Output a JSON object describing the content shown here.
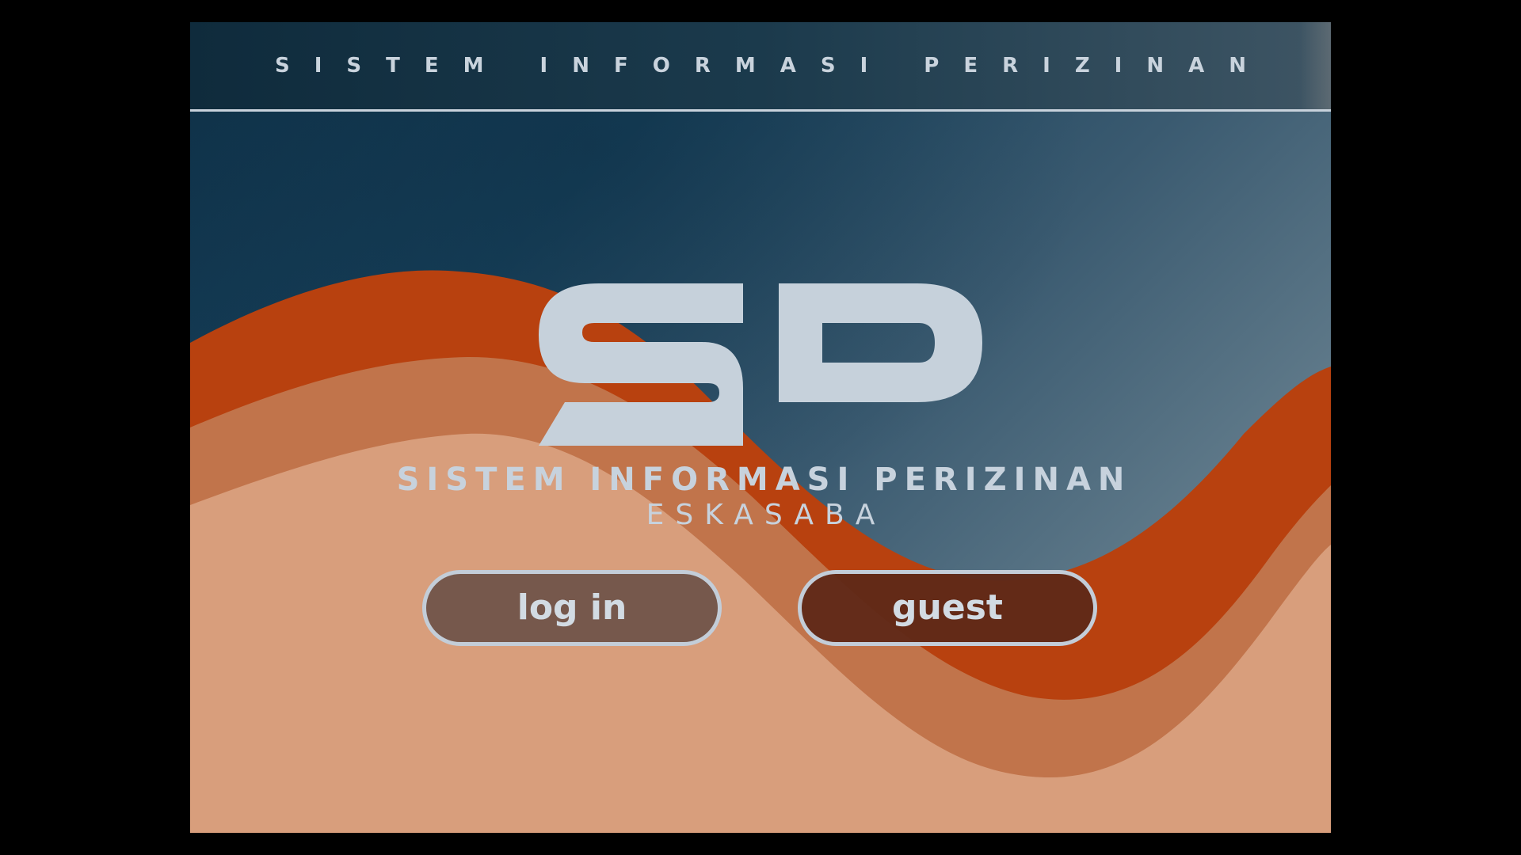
{
  "header": {
    "title": "SISTEM INFORMASI PERIZINAN"
  },
  "brand": {
    "logo_text": "SIP",
    "name": "SISTEM INFORMASI PERIZINAN",
    "subname": "ESKASABA"
  },
  "actions": {
    "login_label": "log in",
    "guest_label": "guest"
  },
  "colors": {
    "background_dark": "#0f3148",
    "background_light": "#8596a2",
    "header_bar": "#163446",
    "wave_dark_orange": "#b8410f",
    "wave_mid_orange": "#c1744b",
    "wave_light_peach": "#d89e7c",
    "text_light": "#c7d2dd",
    "login_button_fill": "#73564a",
    "guest_button_fill": "#602a18"
  }
}
